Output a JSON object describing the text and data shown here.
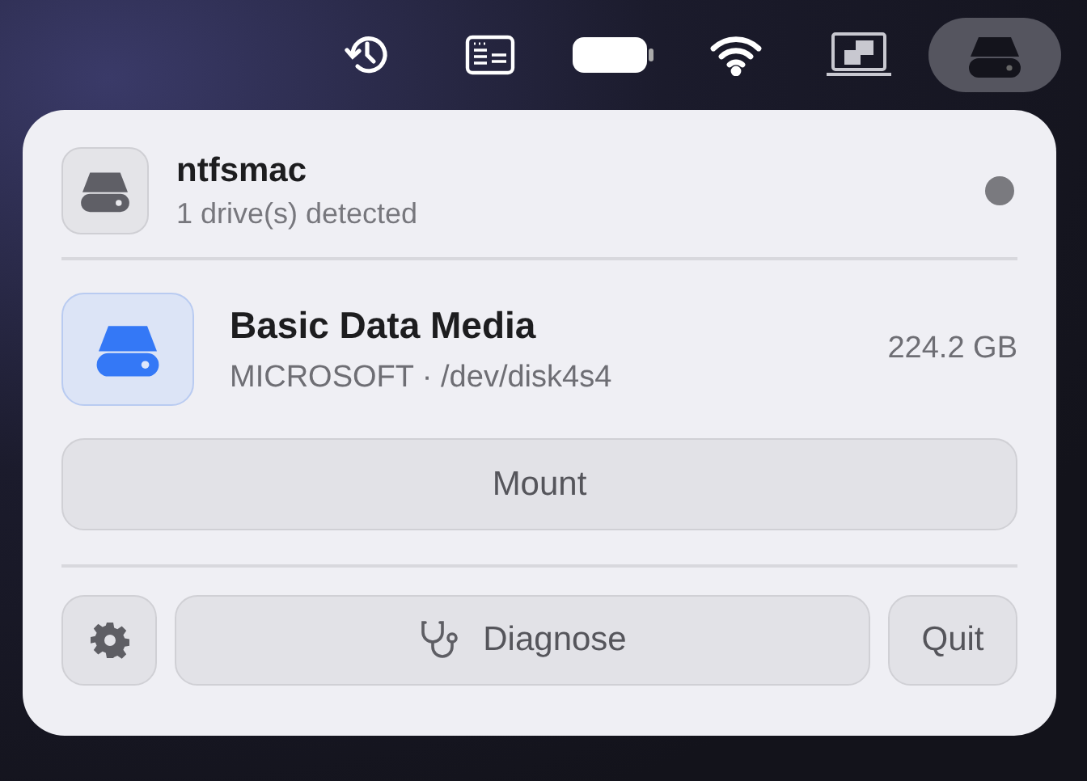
{
  "menu_bar": {
    "items": [
      {
        "kind": "history",
        "selected": false
      },
      {
        "kind": "keyboard",
        "selected": false
      },
      {
        "kind": "battery",
        "selected": false
      },
      {
        "kind": "wifi",
        "selected": false
      },
      {
        "kind": "screen",
        "selected": false
      },
      {
        "kind": "drive",
        "selected": true
      }
    ]
  },
  "popup": {
    "app_name": "ntfsmac",
    "subtitle": "1 drive(s) detected",
    "status_active": false,
    "drives": [
      {
        "name": "Basic Data Media",
        "details": "MICROSOFT · /dev/disk4s4",
        "size": "224.2 GB"
      }
    ],
    "mount_button": "Mount",
    "diagnose_button": "Diagnose",
    "quit_button": "Quit"
  }
}
